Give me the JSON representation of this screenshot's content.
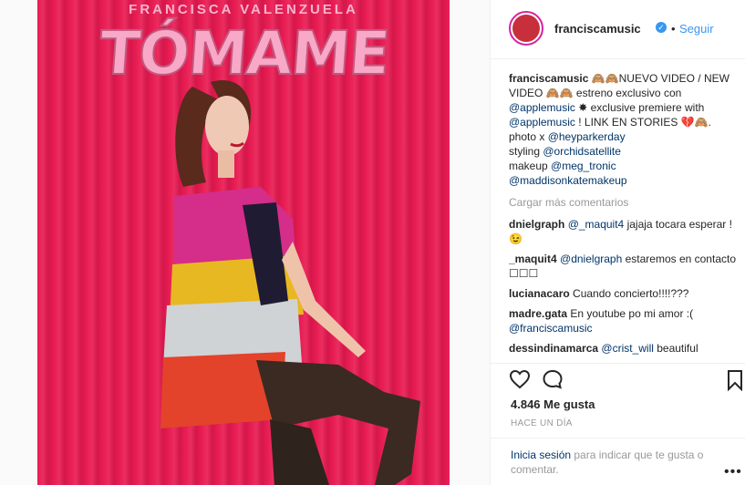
{
  "image": {
    "artist_banner": "FRANCISCA VALENZUELA",
    "song_title": "TÓMAME"
  },
  "header": {
    "username": "franciscamusic",
    "separator": "•",
    "follow_label": "Seguir"
  },
  "caption": {
    "username": "franciscamusic",
    "text_1": " 🙈🙈NUEVO VIDEO / NEW VIDEO 🙈🙈 estreno exclusivo con ",
    "mention_1": "@applemusic",
    "text_2": " ✸ exclusive premiere with ",
    "mention_2": "@applemusic",
    "text_3": " ! LINK EN STORIES 💔🙈. photo x ",
    "mention_3": "@heyparkerday",
    "text_4": " styling ",
    "mention_4": "@orchidsatellite",
    "text_5": " makeup ",
    "mention_5": "@meg_tronic",
    "text_6": " ",
    "mention_6": "@maddisonkatemakeup"
  },
  "load_more_label": "Cargar más comentarios",
  "comments": [
    {
      "user": "dnielgraph",
      "mention": "@_maquit4",
      "text": " jajaja tocara esperar ! 😉"
    },
    {
      "user": "_maquit4",
      "mention": "@dnielgraph",
      "text": " estaremos en contacto ☐☐☐"
    },
    {
      "user": "lucianacaro",
      "mention": "",
      "text": "Cuando concierto!!!!???"
    },
    {
      "user": "madre.gata",
      "mention": "",
      "text": "En youtube po mi amor :( "
    },
    {
      "user": "dessindinamarca",
      "mention": "@crist_will",
      "text": " beautiful vesomo"
    }
  ],
  "madre_gata_mention": "@franciscamusic",
  "likes_text": "4.846 Me gusta",
  "timestamp": "HACE UN DÍA",
  "login": {
    "link": "Inicia sesión",
    "text": " para indicar que te gusta o comentar."
  },
  "icons": {
    "heart": "heart-icon",
    "comment": "comment-icon",
    "bookmark": "bookmark-icon",
    "more": "more-options-icon",
    "verified": "verified-badge-icon"
  },
  "colors": {
    "accent": "#3897f0",
    "mention": "#003569",
    "muted": "#999999",
    "image_background": "#e81c52"
  }
}
